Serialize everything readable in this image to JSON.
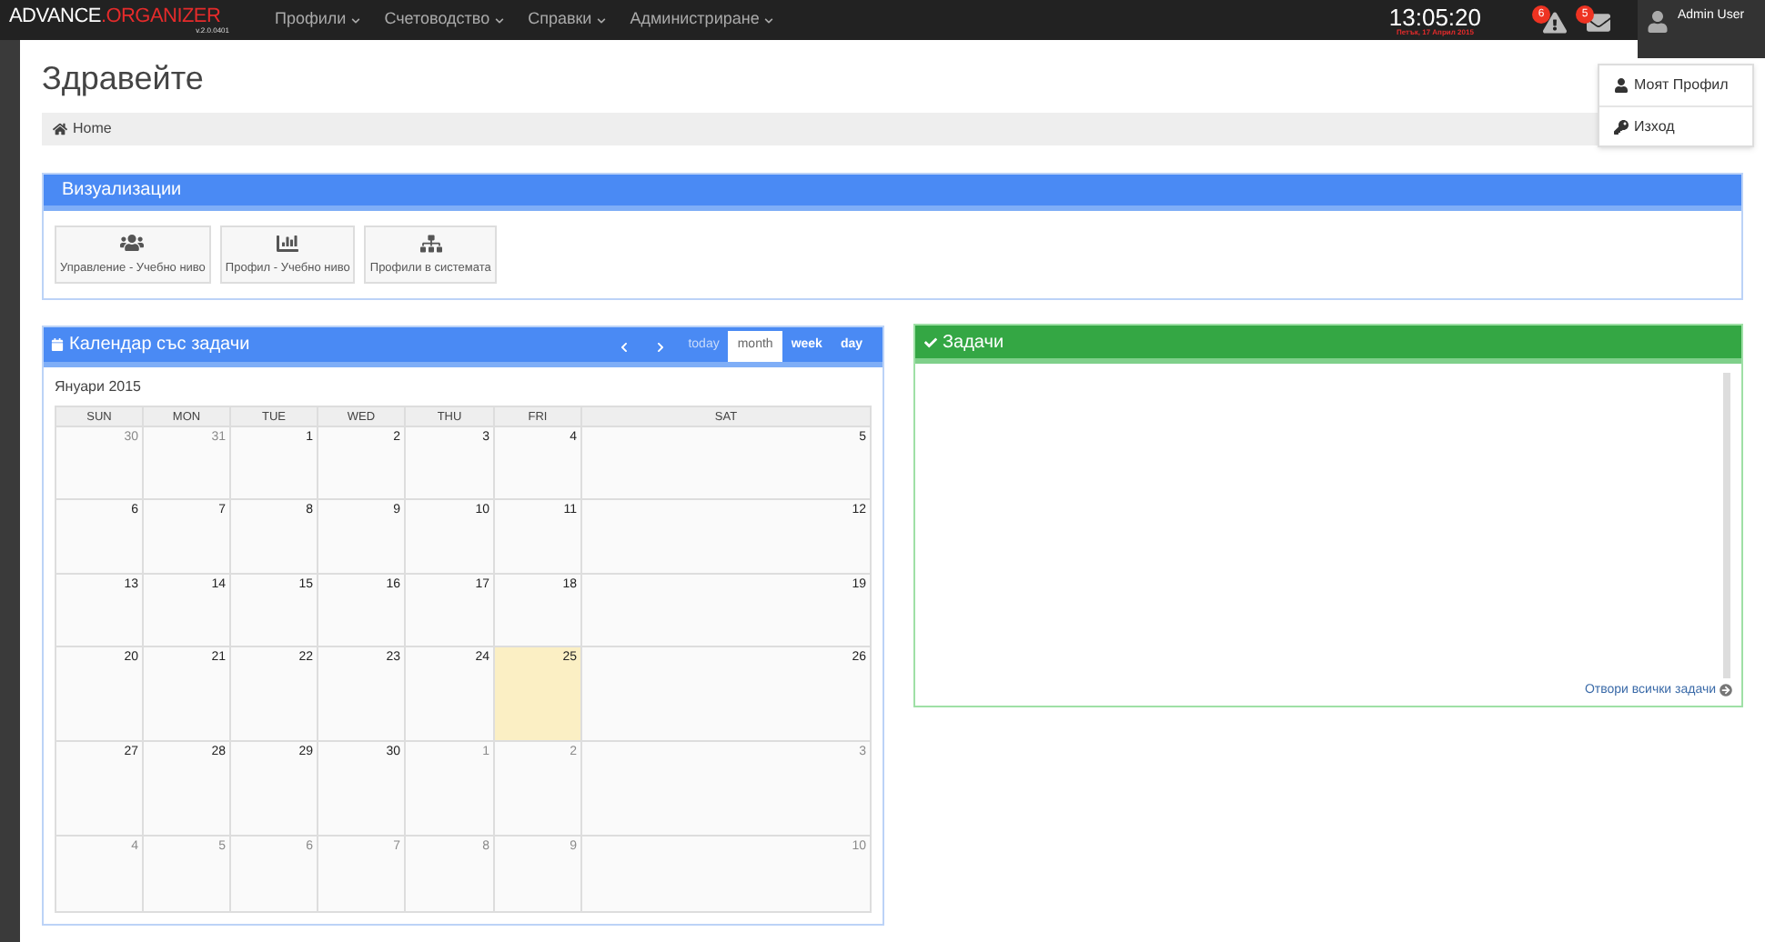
{
  "top_bar": {
    "logo": {
      "part_1": "ADVANCE",
      "part_2": ".ORGANIZER",
      "version": "v.2.0.0401"
    },
    "nav": [
      {
        "label": "Профили"
      },
      {
        "label": "Счетоводство"
      },
      {
        "label": "Справки"
      },
      {
        "label": "Администриране"
      }
    ],
    "clock": {
      "time": "13:05:20",
      "date": "Петък, 17 Април 2015"
    },
    "notifications": [
      {
        "kind": "alert",
        "count": "6"
      },
      {
        "kind": "mail",
        "count": "5"
      }
    ],
    "user": {
      "name": "Admin User"
    }
  },
  "user_menu": [
    {
      "kind": "profile",
      "label": "Моят Профил"
    },
    {
      "kind": "logout",
      "label": "Изход"
    }
  ],
  "page_title": "Здравейте",
  "breadcrumb": [
    {
      "label": "Home"
    }
  ],
  "visualizations": {
    "title": "Визуализации",
    "tiles": [
      {
        "kind": "users",
        "label": "Управление - Учебно ниво"
      },
      {
        "kind": "chart",
        "label": "Профил - Учебно ниво"
      },
      {
        "kind": "tree",
        "label": "Профили в системата"
      }
    ]
  },
  "calendar": {
    "title": "Календар със задачи",
    "views": [
      {
        "label": "today",
        "selected": false,
        "disabled": true
      },
      {
        "label": "month",
        "selected": true,
        "disabled": false
      },
      {
        "label": "week",
        "selected": false,
        "disabled": false
      },
      {
        "label": "day",
        "selected": false,
        "disabled": false
      }
    ],
    "month_label": "Януари 2015",
    "weekdays": [
      "SUN",
      "MON",
      "TUE",
      "WED",
      "THU",
      "FRI",
      "SAT"
    ],
    "weeks": [
      [
        {
          "day": "30",
          "other_month": true,
          "today": false
        },
        {
          "day": "31",
          "other_month": true,
          "today": false
        },
        {
          "day": "1",
          "other_month": false,
          "today": false
        },
        {
          "day": "2",
          "other_month": false,
          "today": false
        },
        {
          "day": "3",
          "other_month": false,
          "today": false
        },
        {
          "day": "4",
          "other_month": false,
          "today": false
        },
        {
          "day": "5",
          "other_month": false,
          "today": false
        }
      ],
      [
        {
          "day": "6",
          "other_month": false,
          "today": false
        },
        {
          "day": "7",
          "other_month": false,
          "today": false
        },
        {
          "day": "8",
          "other_month": false,
          "today": false
        },
        {
          "day": "9",
          "other_month": false,
          "today": false
        },
        {
          "day": "10",
          "other_month": false,
          "today": false
        },
        {
          "day": "11",
          "other_month": false,
          "today": false
        },
        {
          "day": "12",
          "other_month": false,
          "today": false
        }
      ],
      [
        {
          "day": "13",
          "other_month": false,
          "today": false
        },
        {
          "day": "14",
          "other_month": false,
          "today": false
        },
        {
          "day": "15",
          "other_month": false,
          "today": false
        },
        {
          "day": "16",
          "other_month": false,
          "today": false
        },
        {
          "day": "17",
          "other_month": false,
          "today": false
        },
        {
          "day": "18",
          "other_month": false,
          "today": false
        },
        {
          "day": "19",
          "other_month": false,
          "today": false
        }
      ],
      [
        {
          "day": "20",
          "other_month": false,
          "today": false
        },
        {
          "day": "21",
          "other_month": false,
          "today": false
        },
        {
          "day": "22",
          "other_month": false,
          "today": false
        },
        {
          "day": "23",
          "other_month": false,
          "today": false
        },
        {
          "day": "24",
          "other_month": false,
          "today": false
        },
        {
          "day": "25",
          "other_month": false,
          "today": true
        },
        {
          "day": "26",
          "other_month": false,
          "today": false
        }
      ],
      [
        {
          "day": "27",
          "other_month": false,
          "today": false
        },
        {
          "day": "28",
          "other_month": false,
          "today": false
        },
        {
          "day": "29",
          "other_month": false,
          "today": false
        },
        {
          "day": "30",
          "other_month": false,
          "today": false
        },
        {
          "day": "1",
          "other_month": true,
          "today": false
        },
        {
          "day": "2",
          "other_month": true,
          "today": false
        },
        {
          "day": "3",
          "other_month": true,
          "today": false
        }
      ],
      [
        {
          "day": "4",
          "other_month": true,
          "today": false
        },
        {
          "day": "5",
          "other_month": true,
          "today": false
        },
        {
          "day": "6",
          "other_month": true,
          "today": false
        },
        {
          "day": "7",
          "other_month": true,
          "today": false
        },
        {
          "day": "8",
          "other_month": true,
          "today": false
        },
        {
          "day": "9",
          "other_month": true,
          "today": false
        },
        {
          "day": "10",
          "other_month": true,
          "today": false
        }
      ]
    ]
  },
  "tasks": {
    "title": "Задачи",
    "link": "Отвори всички задачи"
  }
}
